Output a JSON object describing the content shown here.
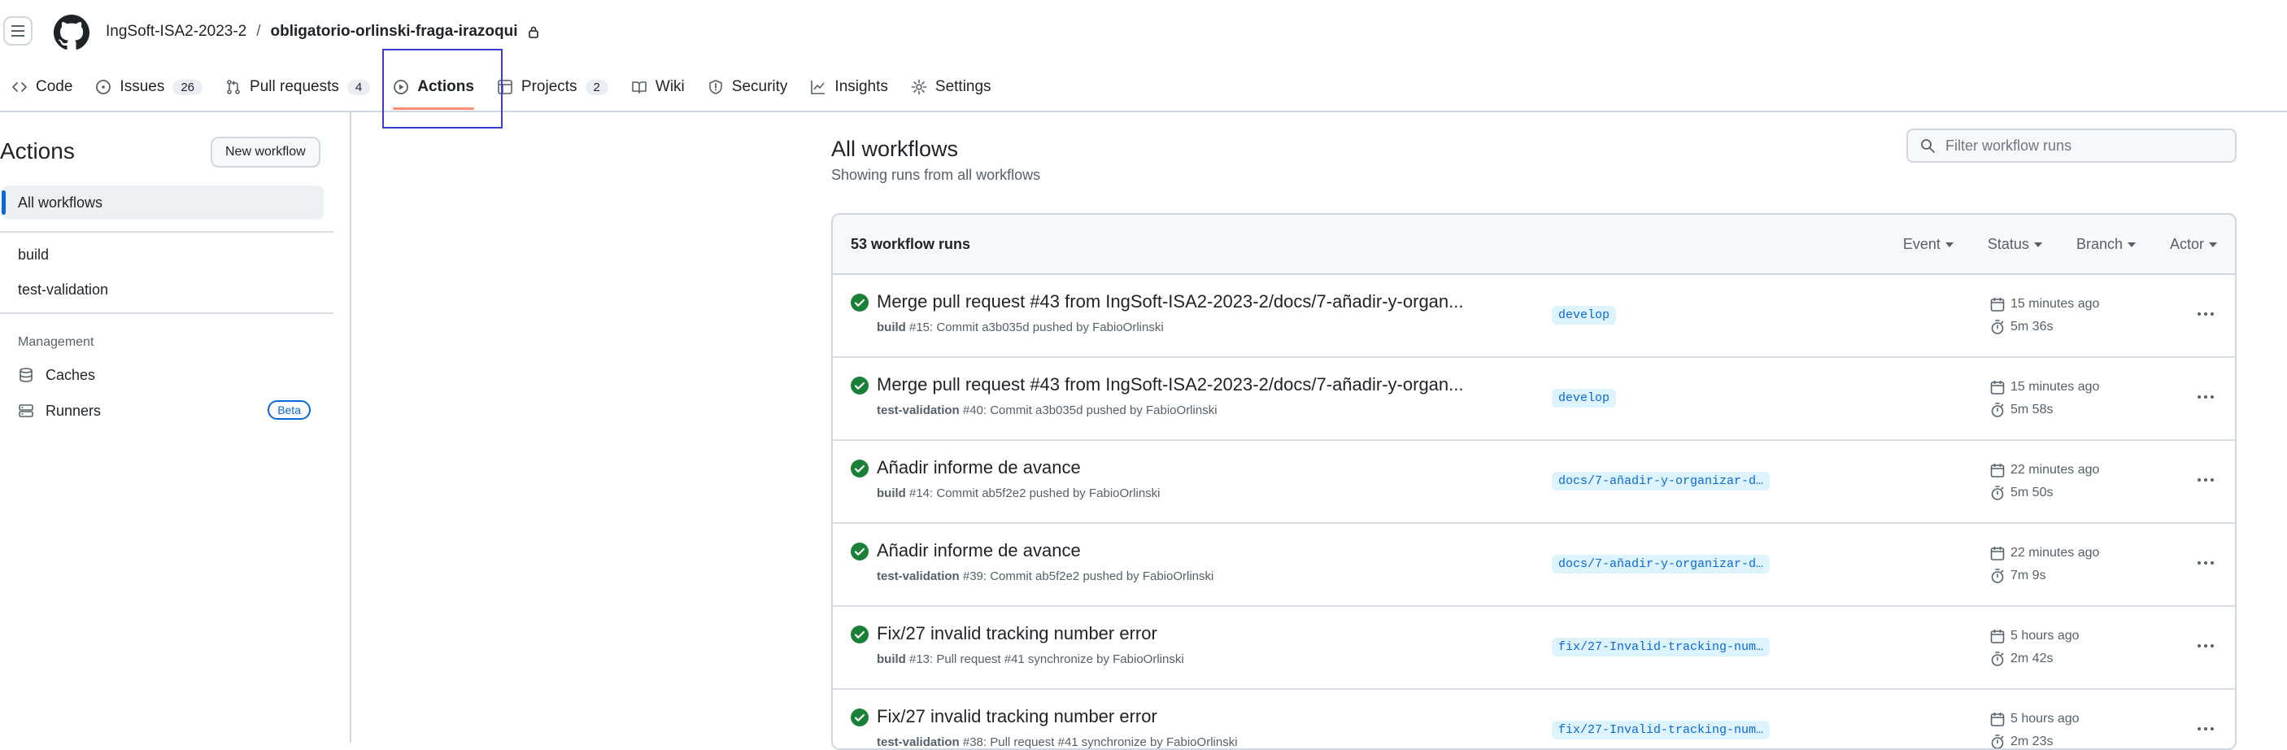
{
  "header": {
    "owner": "IngSoft-ISA2-2023-2",
    "separator": "/",
    "repo": "obligatorio-orlinski-fraga-irazoqui"
  },
  "tabs": [
    {
      "label": "Code",
      "icon": "code-icon"
    },
    {
      "label": "Issues",
      "count": "26",
      "icon": "issue-icon"
    },
    {
      "label": "Pull requests",
      "count": "4",
      "icon": "pull-request-icon"
    },
    {
      "label": "Actions",
      "icon": "play-icon",
      "active": true
    },
    {
      "label": "Projects",
      "count": "2",
      "icon": "table-icon"
    },
    {
      "label": "Wiki",
      "icon": "book-icon"
    },
    {
      "label": "Security",
      "icon": "shield-icon"
    },
    {
      "label": "Insights",
      "icon": "graph-icon"
    },
    {
      "label": "Settings",
      "icon": "gear-icon"
    }
  ],
  "sidebar": {
    "title": "Actions",
    "new_workflow": "New workflow",
    "all_workflows": "All workflows",
    "workflows": [
      "build",
      "test-validation"
    ],
    "management_heading": "Management",
    "caches": "Caches",
    "runners": "Runners",
    "beta": "Beta"
  },
  "main": {
    "title": "All workflows",
    "subtitle": "Showing runs from all workflows",
    "filter_placeholder": "Filter workflow runs",
    "runs_count": "53 workflow runs",
    "filters": [
      "Event",
      "Status",
      "Branch",
      "Actor"
    ]
  },
  "colors": {
    "success": "#1a7f37",
    "branch_bg": "#ddf4ff",
    "branch_fg": "#0969da",
    "active_tab_underline": "#fd8c73"
  },
  "runs": [
    {
      "title": "Merge pull request #43 from IngSoft-ISA2-2023-2/docs/7-añadir-y-organ...",
      "workflow": "build",
      "meta": " #15: Commit a3b035d pushed by FabioOrlinski",
      "branch": "develop",
      "time": "15 minutes ago",
      "duration": "5m 36s"
    },
    {
      "title": "Merge pull request #43 from IngSoft-ISA2-2023-2/docs/7-añadir-y-organ...",
      "workflow": "test-validation",
      "meta": " #40: Commit a3b035d pushed by FabioOrlinski",
      "branch": "develop",
      "time": "15 minutes ago",
      "duration": "5m 58s"
    },
    {
      "title": "Añadir informe de avance",
      "workflow": "build",
      "meta": " #14: Commit ab5f2e2 pushed by FabioOrlinski",
      "branch": "docs/7-añadir-y-organizar-d…",
      "time": "22 minutes ago",
      "duration": "5m 50s"
    },
    {
      "title": "Añadir informe de avance",
      "workflow": "test-validation",
      "meta": " #39: Commit ab5f2e2 pushed by FabioOrlinski",
      "branch": "docs/7-añadir-y-organizar-d…",
      "time": "22 minutes ago",
      "duration": "7m 9s"
    },
    {
      "title": "Fix/27 invalid tracking number error",
      "workflow": "build",
      "meta": " #13: Pull request #41 synchronize by FabioOrlinski",
      "branch": "fix/27-Invalid-tracking-num…",
      "time": "5 hours ago",
      "duration": "2m 42s"
    },
    {
      "title": "Fix/27 invalid tracking number error",
      "workflow": "test-validation",
      "meta": " #38: Pull request #41 synchronize by FabioOrlinski",
      "branch": "fix/27-Invalid-tracking-num…",
      "time": "5 hours ago",
      "duration": "2m 23s"
    }
  ]
}
